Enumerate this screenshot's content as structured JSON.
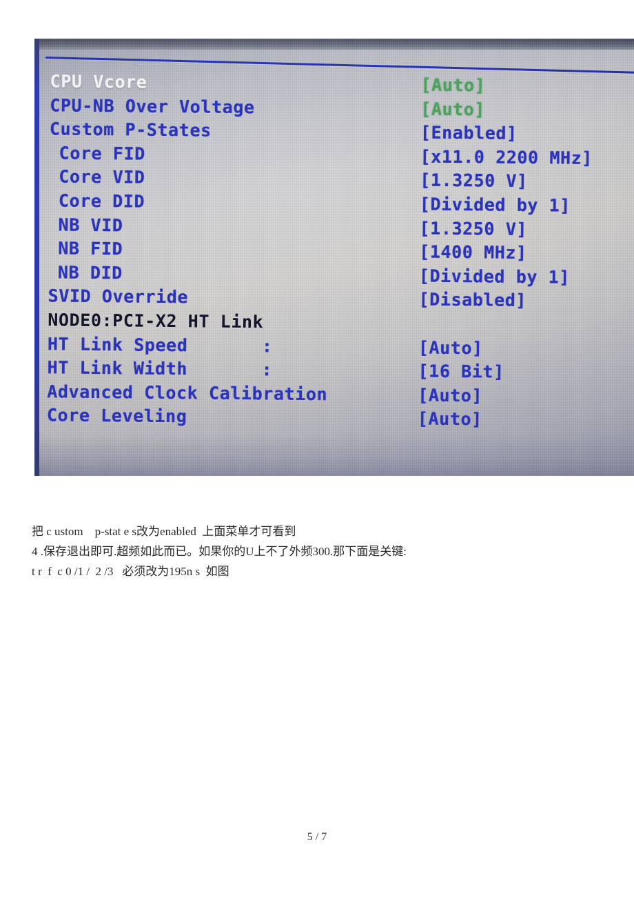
{
  "document": {
    "footer_page": "5 / 7"
  },
  "bios_photo": {
    "screen_title_rule": "header-separator",
    "rows": [
      {
        "label": "CPU Vcore",
        "indent": 0,
        "label_color": "white",
        "colon": "",
        "value": "[Auto]",
        "value_color": "green"
      },
      {
        "label": "CPU-NB Over Voltage",
        "indent": 0,
        "label_color": "blue",
        "colon": "",
        "value": "[Auto]",
        "value_color": "green"
      },
      {
        "label": "Custom P-States",
        "indent": 0,
        "label_color": "blue",
        "colon": "",
        "value": "[Enabled]",
        "value_color": "blue"
      },
      {
        "label": "Core FID",
        "indent": 1,
        "label_color": "blue",
        "colon": "",
        "value": "[x11.0 2200 MHz]",
        "value_color": "blue"
      },
      {
        "label": "Core VID",
        "indent": 1,
        "label_color": "blue",
        "colon": "",
        "value": "[1.3250 V]",
        "value_color": "blue"
      },
      {
        "label": "Core DID",
        "indent": 1,
        "label_color": "blue",
        "colon": "",
        "value": "[Divided by 1]",
        "value_color": "blue"
      },
      {
        "label": "NB VID",
        "indent": 1,
        "label_color": "blue",
        "colon": "",
        "value": "[1.3250 V]",
        "value_color": "blue"
      },
      {
        "label": "NB FID",
        "indent": 1,
        "label_color": "blue",
        "colon": "",
        "value": "[1400 MHz]",
        "value_color": "blue"
      },
      {
        "label": "NB DID",
        "indent": 1,
        "label_color": "blue",
        "colon": "",
        "value": "[Divided by 1]",
        "value_color": "blue"
      },
      {
        "label": "SVID Override",
        "indent": 0,
        "label_color": "blue",
        "colon": "",
        "value": "[Disabled]",
        "value_color": "blue"
      },
      {
        "label": "NODE0:PCI-X2 HT Link",
        "indent": 0,
        "label_color": "dark",
        "colon": "",
        "value": "",
        "value_color": "blue"
      },
      {
        "label": "HT Link Speed",
        "indent": 0,
        "label_color": "blue",
        "colon": ":",
        "value": "[Auto]",
        "value_color": "blue"
      },
      {
        "label": "HT Link Width",
        "indent": 0,
        "label_color": "blue",
        "colon": ":",
        "value": "[16 Bit]",
        "value_color": "blue"
      },
      {
        "label": "Advanced Clock Calibration",
        "indent": 0,
        "label_color": "blue",
        "colon": "",
        "value": "[Auto]",
        "value_color": "blue"
      },
      {
        "label": "Core Leveling",
        "indent": 0,
        "label_color": "blue",
        "colon": "",
        "value": "[Auto]",
        "value_color": "blue"
      }
    ]
  },
  "caption": {
    "lines": [
      "把 c ustom    p-stat e s改为enabled  上面菜单才可看到",
      "4 .保存退出即可.超频如此而已。如果你的U上不了外频300.那下面是关键:",
      "t r  f  c 0 /1 /  2 /3   必须改为195n s  如图"
    ]
  },
  "colors": {
    "bios_blue": "#2b34b8",
    "bios_green": "#4fa05e",
    "bios_white": "#f2f2f4",
    "bios_dark": "#14142a",
    "screen_bg": "#c6c6ca"
  }
}
